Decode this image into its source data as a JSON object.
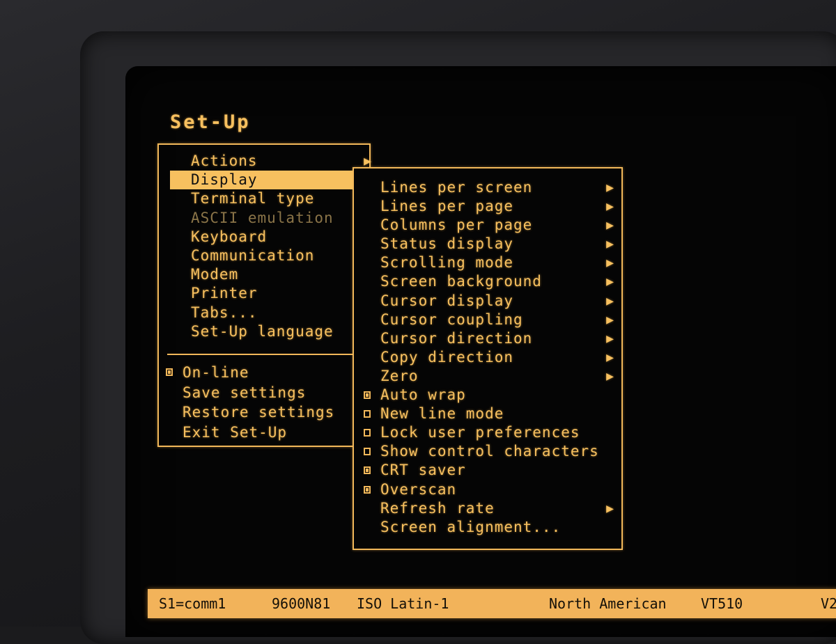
{
  "title": "Set-Up",
  "main_menu": {
    "items": [
      {
        "label": "Actions",
        "arrow": "▶",
        "state": "normal"
      },
      {
        "label": "Display",
        "arrow": "▶",
        "state": "selected"
      },
      {
        "label": "Terminal type",
        "arrow": "▶",
        "state": "normal"
      },
      {
        "label": "ASCII emulation",
        "arrow": "▶",
        "state": "disabled"
      },
      {
        "label": "Keyboard",
        "arrow": "▶",
        "state": "normal"
      },
      {
        "label": "Communication",
        "arrow": "▶",
        "state": "normal"
      },
      {
        "label": "Modem",
        "arrow": "▶",
        "state": "normal"
      },
      {
        "label": "Printer",
        "arrow": "▶",
        "state": "normal"
      },
      {
        "label": "Tabs...",
        "arrow": "",
        "state": "normal"
      },
      {
        "label": "Set-Up language",
        "arrow": "▶",
        "state": "normal"
      }
    ],
    "actions": [
      {
        "label": "On-line",
        "checkbox": "checked"
      },
      {
        "label": "Save settings",
        "checkbox": "none"
      },
      {
        "label": "Restore settings",
        "checkbox": "none"
      },
      {
        "label": "Exit Set-Up",
        "checkbox": "none"
      }
    ]
  },
  "display_submenu": {
    "items": [
      {
        "label": "Lines per screen",
        "arrow": "▶",
        "checkbox": "none"
      },
      {
        "label": "Lines per page",
        "arrow": "▶",
        "checkbox": "none"
      },
      {
        "label": "Columns per page",
        "arrow": "▶",
        "checkbox": "none"
      },
      {
        "label": "Status display",
        "arrow": "▶",
        "checkbox": "none"
      },
      {
        "label": "Scrolling mode",
        "arrow": "▶",
        "checkbox": "none"
      },
      {
        "label": "Screen background",
        "arrow": "▶",
        "checkbox": "none"
      },
      {
        "label": "Cursor display",
        "arrow": "▶",
        "checkbox": "none"
      },
      {
        "label": "Cursor coupling",
        "arrow": "▶",
        "checkbox": "none"
      },
      {
        "label": "Cursor direction",
        "arrow": "▶",
        "checkbox": "none"
      },
      {
        "label": "Copy direction",
        "arrow": "▶",
        "checkbox": "none"
      },
      {
        "label": "Zero",
        "arrow": "▶",
        "checkbox": "none"
      },
      {
        "label": "Auto wrap",
        "arrow": "",
        "checkbox": "checked"
      },
      {
        "label": "New line mode",
        "arrow": "",
        "checkbox": "unchecked"
      },
      {
        "label": "Lock user preferences",
        "arrow": "",
        "checkbox": "unchecked"
      },
      {
        "label": "Show control characters",
        "arrow": "",
        "checkbox": "unchecked"
      },
      {
        "label": "CRT saver",
        "arrow": "",
        "checkbox": "checked"
      },
      {
        "label": "Overscan",
        "arrow": "",
        "checkbox": "checked"
      },
      {
        "label": "Refresh rate",
        "arrow": "▶",
        "checkbox": "none"
      },
      {
        "label": "Screen alignment...",
        "arrow": "",
        "checkbox": "none"
      }
    ]
  },
  "status_bar": {
    "session": "S1=comm1",
    "line_settings": "9600N81",
    "charset": "ISO Latin-1",
    "keyboard": "North American",
    "model": "VT510",
    "version": "V2"
  },
  "colors": {
    "amber": "#f7c05f",
    "background": "#050505",
    "disabled": "#8a7448"
  }
}
